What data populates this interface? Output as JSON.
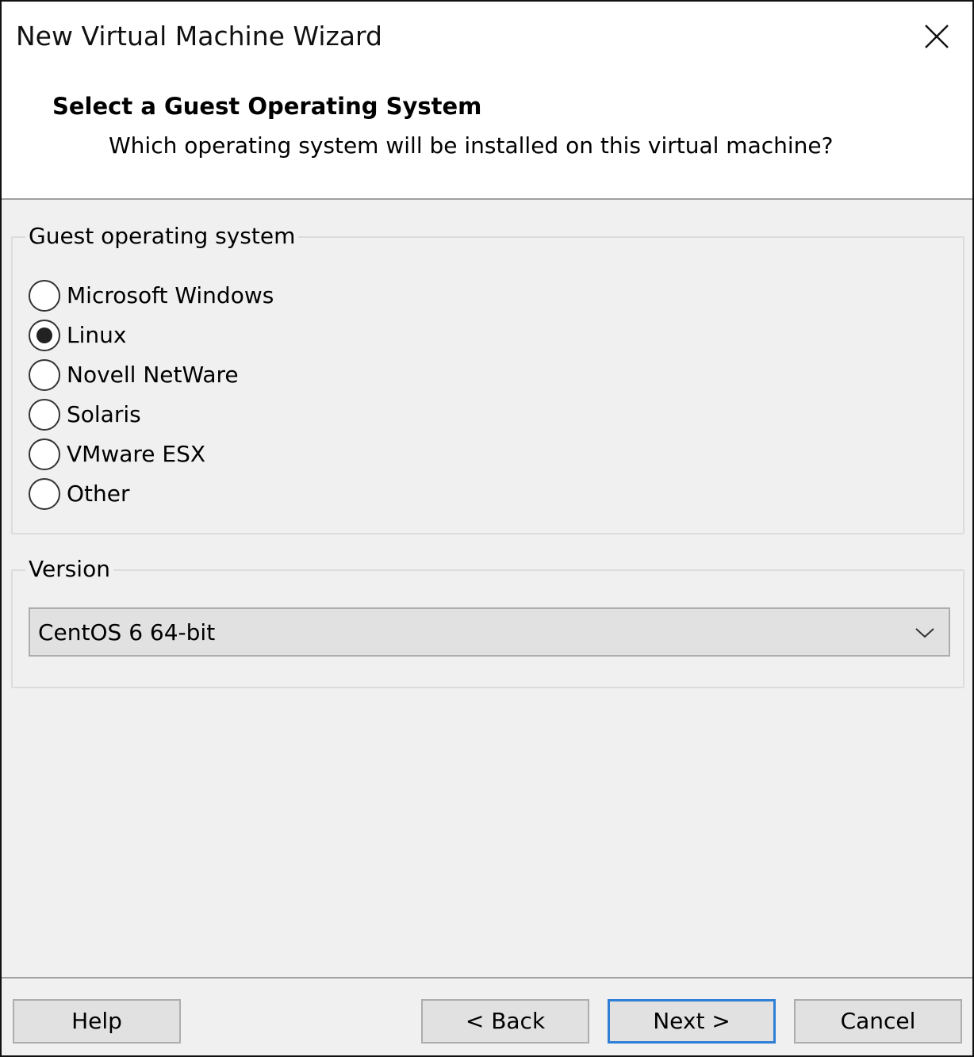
{
  "window": {
    "title": "New Virtual Machine Wizard"
  },
  "header": {
    "title": "Select a Guest Operating System",
    "subtitle": "Which operating system will be installed on this virtual machine?"
  },
  "guest_os_group": {
    "label": "Guest operating system",
    "options": [
      {
        "label": "Microsoft Windows",
        "checked": false
      },
      {
        "label": "Linux",
        "checked": true
      },
      {
        "label": "Novell NetWare",
        "checked": false
      },
      {
        "label": "Solaris",
        "checked": false
      },
      {
        "label": "VMware ESX",
        "checked": false
      },
      {
        "label": "Other",
        "checked": false
      }
    ]
  },
  "version_group": {
    "label": "Version",
    "selected": "CentOS 6 64-bit"
  },
  "buttons": {
    "help": "Help",
    "back": "< Back",
    "next": "Next >",
    "cancel": "Cancel"
  },
  "icons": {
    "close": "close-icon",
    "dropdown": "chevron-down-icon"
  },
  "colors": {
    "default_button_border": "#2f7fd6",
    "dialog_background": "#f0f0f0",
    "button_face": "#e1e1e1"
  }
}
